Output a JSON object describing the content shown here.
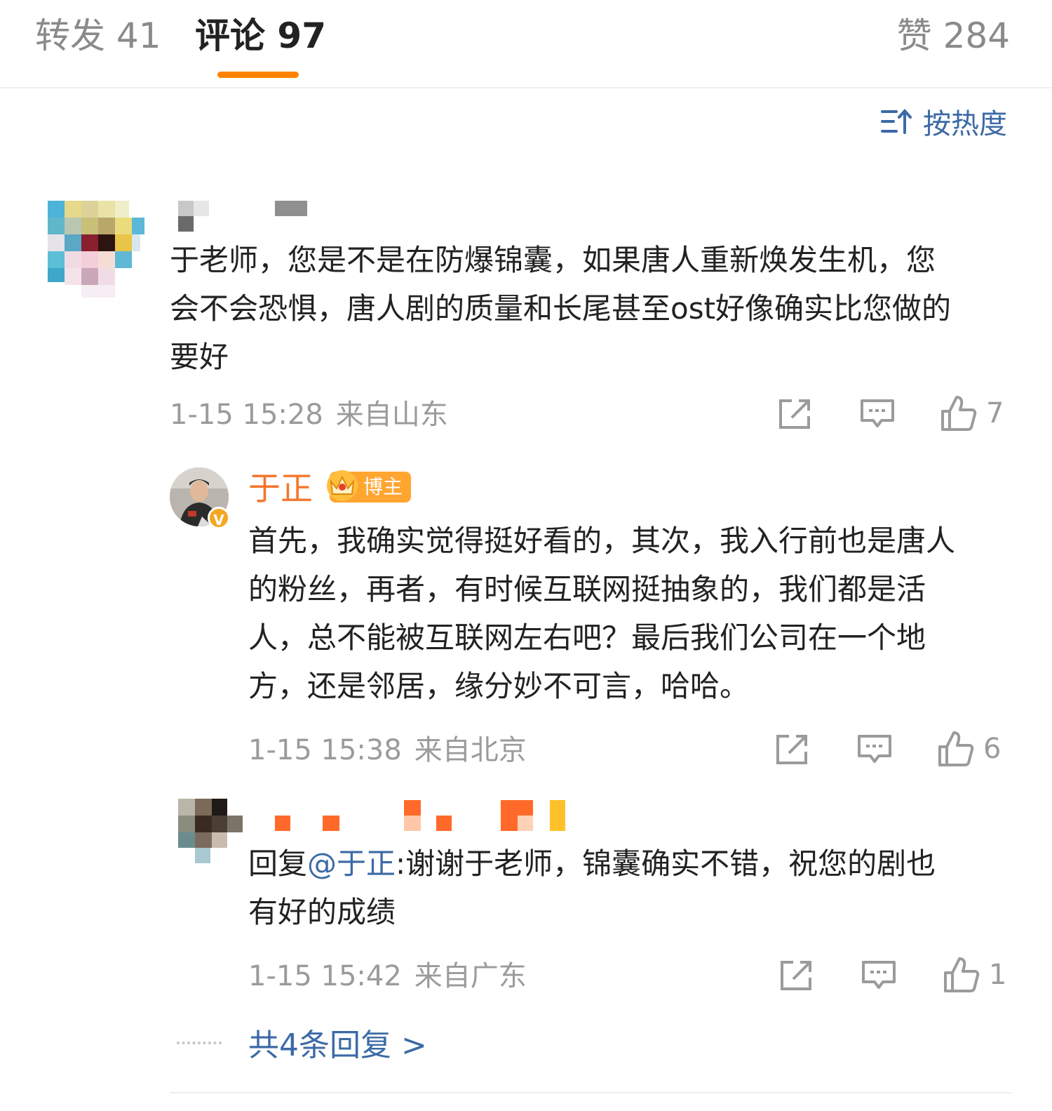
{
  "tabs": {
    "repost": "转发 41",
    "comments": "评论 97",
    "likes": "赞 284"
  },
  "sort": {
    "label": "按热度",
    "icon": "sort-icon"
  },
  "comment1": {
    "lines": [
      "于老师，您是不是在防爆锦囊，如果唐人重新焕发生机，您",
      "会不会恐惧，唐人剧的质量和长尾甚至ost好像确实比您做的",
      "要好"
    ],
    "date": "1-15 15:28",
    "location": "来自山东",
    "likes": "7"
  },
  "reply1": {
    "author": "于正",
    "badge": "博主",
    "verified_mark": "V",
    "lines": [
      "首先，我确实觉得挺好看的，其次，我入行前也是唐人",
      "的粉丝，再者，有时候互联网挺抽象的，我们都是活",
      "人，总不能被互联网左右吧？最后我们公司在一个地",
      "方，还是邻居，缘分妙不可言，哈哈。"
    ],
    "date": "1-15 15:38",
    "location": "来自北京",
    "likes": "6"
  },
  "reply2": {
    "prefix": "回复",
    "mention": "@于正",
    "line1_rest": ":谢谢于老师，锦囊确实不错，祝您的剧也",
    "line2": "有好的成绩",
    "date": "1-15 15:42",
    "location": "来自广东",
    "likes": "1"
  },
  "more_replies": "共4条回复 >",
  "colors": {
    "accent_orange": "#ff8200",
    "link_blue": "#3c6aa6",
    "meta_gray": "#9b9b9b"
  }
}
